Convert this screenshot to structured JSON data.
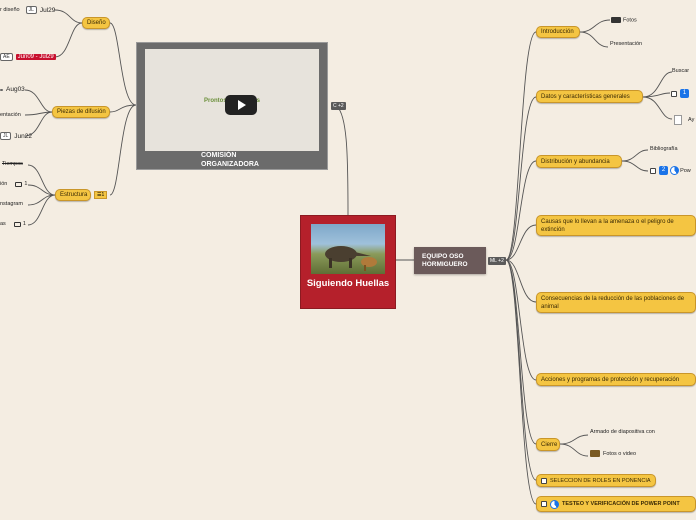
{
  "central": {
    "title": "Siguiendo Huellas"
  },
  "team": {
    "label": "EQUIPO OSO HORMIGUERO",
    "tag": "ML +2"
  },
  "video": {
    "overlay_label": "Prontos a ser libres",
    "caption": "COMISIÓN ORGANIZADORA",
    "tag": "C +2"
  },
  "left": {
    "diseno": {
      "label": "Diseño",
      "leaf1": "r diseño",
      "leaf1_badge": "JL",
      "leaf1_date": "Jul29",
      "leaf2_badge": "AE",
      "leaf2_date": "Jun09 - Jul29"
    },
    "piezas": {
      "label": "Piezas de difusión",
      "leaf1_date": "Aug03",
      "leaf2": "entación",
      "leaf3_badge": "JL",
      "leaf3_date": "Jun22"
    },
    "estructura": {
      "label": "Estructura",
      "tag": "1",
      "leaf1": "Tiempos",
      "leaf2": "ión",
      "leaf2_count": "1",
      "leaf3": "nstagram",
      "leaf4": "as",
      "leaf4_count": "1"
    }
  },
  "right": {
    "introduccion": {
      "label": "Introducción",
      "leaf1": "Fotos",
      "leaf2": "Presentación"
    },
    "datos": {
      "label": "Datos y características generales",
      "leaf1": "Buscar",
      "leaf2_num": "1",
      "leaf3": "Ay"
    },
    "distribucion": {
      "label": "Distribución y abundancia",
      "leaf1": "Bibliografía",
      "leaf2_num": "2",
      "leaf2": "Pow"
    },
    "causas": {
      "label": "Causas que lo llevan a la amenaza o el peligro de extinción"
    },
    "consecuencias": {
      "label": "Consecuencias de la reducción de las poblaciones de animal"
    },
    "acciones": {
      "label": "Acciones y programas de protección y recuperación"
    },
    "cierre": {
      "label": "Cierre",
      "leaf1": "Armado de diapositiva con",
      "leaf2": "Fotos o video"
    },
    "seleccion": {
      "label": "SELECCION DE ROLES EN PONENCIA"
    },
    "testeo": {
      "label": "TESTEO Y VERIFICACIÓN DE POWER POINT"
    }
  },
  "colors": {
    "background": "#f4ede2",
    "node": "#f4c542",
    "central": "#b5202b",
    "team": "#6b5a5a",
    "line": "#555555"
  }
}
